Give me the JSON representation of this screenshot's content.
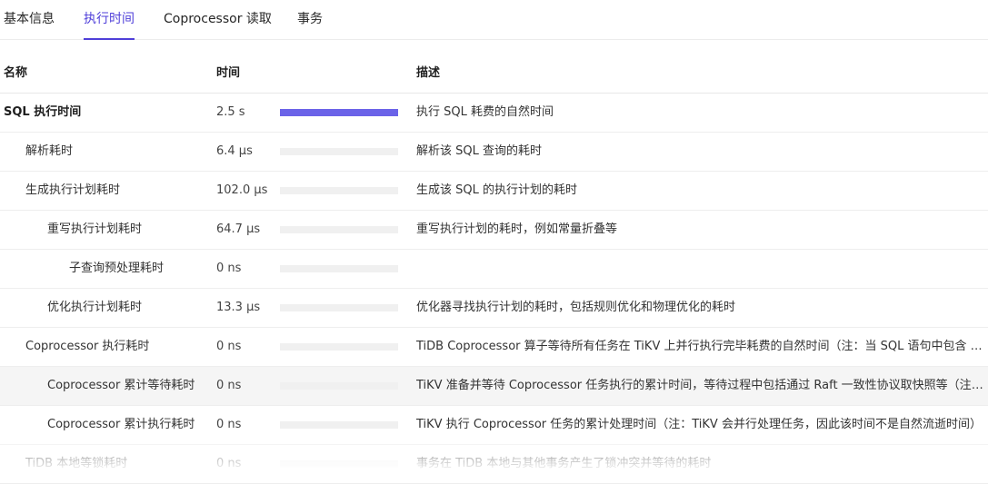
{
  "tabs": [
    {
      "label": "基本信息",
      "active": false
    },
    {
      "label": "执行时间",
      "active": true
    },
    {
      "label": "Coprocessor 读取",
      "active": false
    },
    {
      "label": "事务",
      "active": false
    }
  ],
  "table": {
    "headers": {
      "name": "名称",
      "time": "时间",
      "desc": "描述"
    },
    "rows": [
      {
        "name": "SQL 执行时间",
        "time": "2.5 s",
        "ratio": 1.0,
        "desc": "执行 SQL 耗费的自然时间"
      },
      {
        "name": "解析耗时",
        "time": "6.4 µs",
        "ratio": 0,
        "desc": "解析该 SQL 查询的耗时"
      },
      {
        "name": "生成执行计划耗时",
        "time": "102.0 µs",
        "ratio": 0,
        "desc": "生成该 SQL 的执行计划的耗时"
      },
      {
        "name": "重写执行计划耗时",
        "time": "64.7 µs",
        "ratio": 0,
        "desc": "重写执行计划的耗时，例如常量折叠等"
      },
      {
        "name": "子查询预处理耗时",
        "time": "0 ns",
        "ratio": 0,
        "desc": ""
      },
      {
        "name": "优化执行计划耗时",
        "time": "13.3 µs",
        "ratio": 0,
        "desc": "优化器寻找执行计划的耗时，包括规则优化和物理优化的耗时"
      },
      {
        "name": "Coprocessor 执行耗时",
        "time": "0 ns",
        "ratio": 0,
        "desc": "TiDB Coprocessor 算子等待所有任务在 TiKV 上并行执行完毕耗费的自然时间（注：当 SQL 语句中包含 JOI..."
      },
      {
        "name": "Coprocessor 累计等待耗时",
        "time": "0 ns",
        "ratio": 0,
        "desc": "TiKV 准备并等待 Coprocessor 任务执行的累计时间，等待过程中包括通过 Raft 一致性协议取快照等（注：Ti..."
      },
      {
        "name": "Coprocessor 累计执行耗时",
        "time": "0 ns",
        "ratio": 0,
        "desc": "TiKV 执行 Coprocessor 任务的累计处理时间（注：TiKV 会并行处理任务，因此该时间不是自然流逝时间）"
      },
      {
        "name": "TiDB 本地等锁耗时",
        "time": "0 ns",
        "ratio": 0,
        "desc": "事务在 TiDB 本地与其他事务产生了锁冲突并等待的耗时"
      }
    ]
  },
  "colors": {
    "accent": "#4f3fd9",
    "bar_fill": "#6b63e8",
    "bar_track": "#f0f0f0"
  }
}
